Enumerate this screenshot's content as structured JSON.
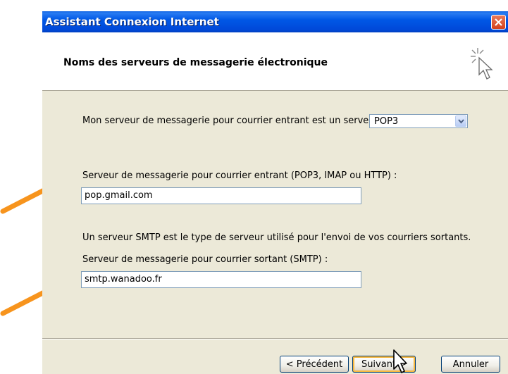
{
  "window": {
    "title": "Assistant Connexion Internet"
  },
  "header": {
    "title": "Noms des serveurs de messagerie électronique"
  },
  "incoming_type": {
    "label": "Mon serveur de messagerie pour courrier entrant est un serveur",
    "selected": "POP3"
  },
  "incoming_server": {
    "label": "Serveur de messagerie pour courrier entrant (POP3, IMAP ou HTTP) :",
    "value": "pop.gmail.com"
  },
  "smtp_info": "Un serveur SMTP est le type de serveur utilisé pour l'envoi de vos courriers sortants.",
  "outgoing_server": {
    "label": "Serveur de messagerie pour courrier sortant (SMTP) :",
    "value": "smtp.wanadoo.fr"
  },
  "buttons": {
    "back": "< Précédent",
    "next": "Suivant >",
    "cancel": "Annuler"
  },
  "colors": {
    "annotation_arrow": "#f7941d",
    "titlebar": "#0054e3",
    "dialog_bg": "#ece9d8"
  }
}
